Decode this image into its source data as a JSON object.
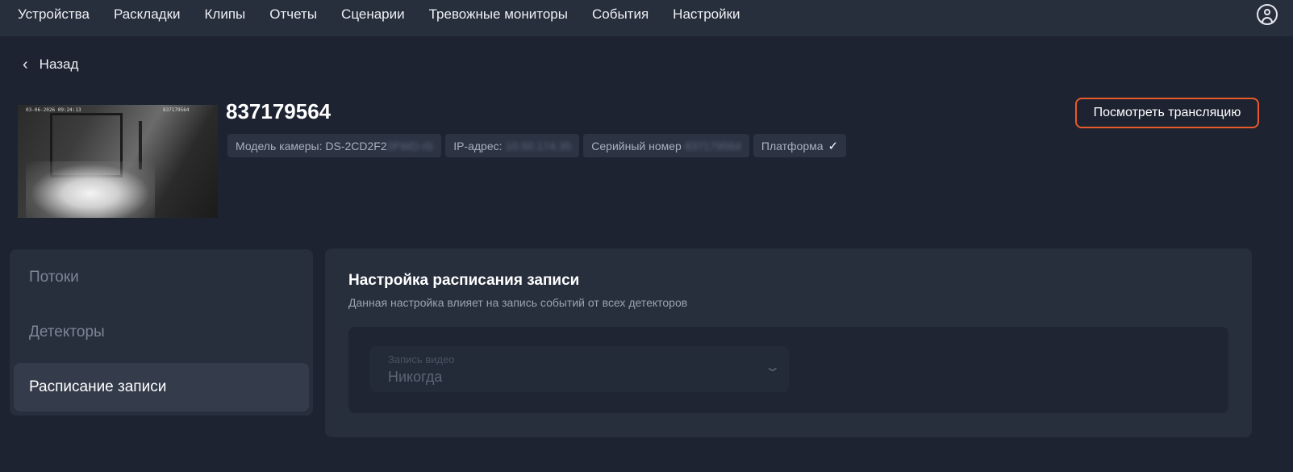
{
  "nav": {
    "items": [
      "Устройства",
      "Раскладки",
      "Клипы",
      "Отчеты",
      "Сценарии",
      "Тревожные мониторы",
      "События",
      "Настройки"
    ]
  },
  "back": {
    "label": "Назад"
  },
  "camera": {
    "title": "837179564",
    "osd_left": "03-06-2026 09:24:13",
    "osd_right": "837179564",
    "chips": {
      "model_label": "Модель камеры: DS-2CD2F2",
      "model_hidden": "2FWD-IS",
      "ip_label": "IP-адрес:",
      "ip_hidden": "10.50.174.35",
      "serial_label": "Серийный номер",
      "serial_hidden": "837179564",
      "platform_label": "Платформа"
    },
    "watch_button": "Посмотреть трансляцию"
  },
  "tabs": [
    "Потоки",
    "Детекторы",
    "Расписание записи"
  ],
  "active_tab": "Расписание записи",
  "panel": {
    "title": "Настройка расписания записи",
    "subtitle": "Данная настройка влияет на запись событий от всех детекторов",
    "select": {
      "label": "Запись видео",
      "value": "Никогда"
    }
  },
  "colors": {
    "accent": "#e85a2b",
    "background": "#1d2331",
    "surface": "#272e3c"
  },
  "icons": {
    "profile": "user-circle-icon",
    "back": "chevron-left-icon",
    "select": "chevron-down-icon",
    "platform": "check-icon"
  }
}
